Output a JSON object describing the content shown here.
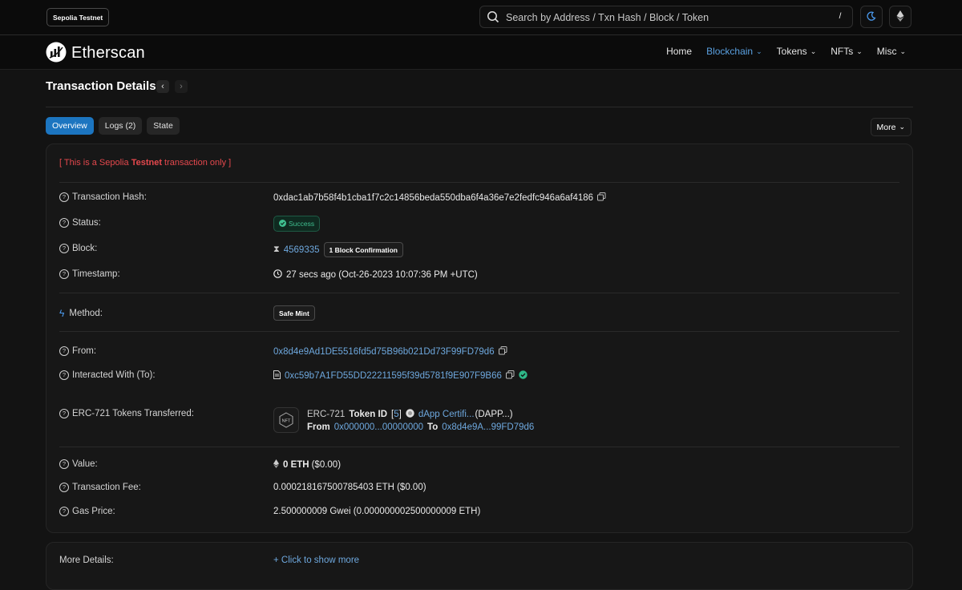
{
  "network_badge": "Sepolia Testnet",
  "search": {
    "placeholder": "Search by Address / Txn Hash / Block / Token",
    "shortcut": "/"
  },
  "brand": "Etherscan",
  "nav": [
    {
      "label": "Home"
    },
    {
      "label": "Blockchain"
    },
    {
      "label": "Tokens"
    },
    {
      "label": "NFTs"
    },
    {
      "label": "Misc"
    }
  ],
  "page_title": "Transaction Details",
  "tabs": {
    "overview": "Overview",
    "logs": "Logs (2)",
    "state": "State"
  },
  "more_label": "More",
  "warning": {
    "pre": "[ This is a Sepolia ",
    "bold": "Testnet",
    "post": " transaction only ]"
  },
  "rows": {
    "tx_hash": {
      "label": "Transaction Hash:",
      "value": "0xdac1ab7b58f4b1cba1f7c2c14856beda550dba6f4a36e7e2fedfc946a6af4186"
    },
    "status": {
      "label": "Status:",
      "value": "Success"
    },
    "block": {
      "label": "Block:",
      "value": "4569335",
      "confirmations": "1 Block Confirmation"
    },
    "timestamp": {
      "label": "Timestamp:",
      "value": "27 secs ago (Oct-26-2023 10:07:36 PM +UTC)"
    },
    "method": {
      "label": "Method:",
      "value": "Safe Mint"
    },
    "from": {
      "label": "From:",
      "value": "0x8d4e9Ad1DE5516fd5d75B96b021Dd73F99FD79d6"
    },
    "to": {
      "label": "Interacted With (To):",
      "value": "0xc59b7A1FD55DD22211595f39d5781f9E907F9B66"
    },
    "erc721": {
      "label": "ERC-721 Tokens Transferred:",
      "standard": "ERC-721",
      "token_id_label": "Token ID",
      "bracket_open": "[",
      "token_id": "5",
      "bracket_close": "]",
      "token_name": "dApp Certifi...",
      "token_symbol": "(DAPP...)",
      "from_label": "From",
      "from": "0x000000...00000000",
      "to_label": "To",
      "to": "0x8d4e9A...99FD79d6",
      "icon_text": "NFT"
    },
    "value": {
      "label": "Value:",
      "value": "0 ETH",
      "usd": "($0.00)"
    },
    "fee": {
      "label": "Transaction Fee:",
      "value": "0.000218167500785403 ETH ($0.00)"
    },
    "gas": {
      "label": "Gas Price:",
      "value": "2.500000009 Gwei (0.000000002500000009 ETH)"
    }
  },
  "more_details": {
    "label": "More Details:",
    "link": "+ Click to show more"
  }
}
